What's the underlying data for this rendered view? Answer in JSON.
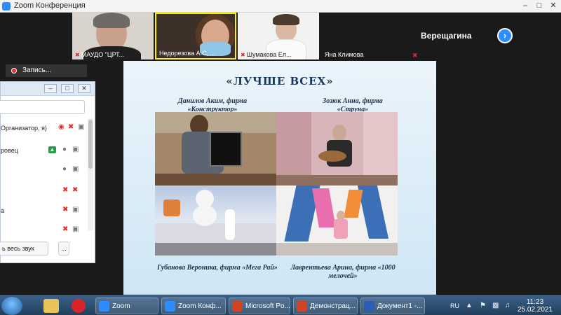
{
  "window": {
    "title": "Zoom Конференция"
  },
  "video_strip": {
    "tiles": [
      {
        "name": "МАУДО \"ЦРТ..."
      },
      {
        "name": "Недорезова А.С, ..."
      },
      {
        "name": "Шумакова Ел..."
      },
      {
        "name": "Яна Климова"
      }
    ],
    "active_speaker": "Верещагина"
  },
  "recording": {
    "label": "Запись..."
  },
  "slide": {
    "title": "«ЛУЧШЕ ВСЕХ»",
    "captions": {
      "top_left": "Данилов Аким, фирма «Конструктор»",
      "top_right": "Зозюк Анна, фирма «Струна»",
      "bottom_left": "Губанова Вероника, фирма «Мега Рай»",
      "bottom_right": "Лаврентьева Арина, фирма «1000 мелочей»"
    }
  },
  "participants_panel": {
    "rows": [
      {
        "text": "Организатор, я)"
      },
      {
        "text": "ровец"
      },
      {
        "text": ""
      },
      {
        "text": ""
      },
      {
        "text": "а"
      },
      {
        "text": ""
      }
    ],
    "footer": {
      "mute_all": "ь весь звук",
      "more": "..."
    }
  },
  "taskbar": {
    "tasks": [
      {
        "label": "Zoom"
      },
      {
        "label": "Zoom Конф..."
      },
      {
        "label": "Microsoft Po..."
      },
      {
        "label": "Демонстрац..."
      },
      {
        "label": "Документ1 -..."
      }
    ],
    "lang": "RU",
    "time": "11:23",
    "date": "25.02.2021"
  },
  "colors": {
    "zoom_blue": "#2d8cff",
    "muted_red": "#e02828",
    "slide_title": "#17365d"
  },
  "icons": [
    "zoom-app-icon",
    "minimize-icon",
    "maximize-icon",
    "close-icon",
    "muted-mic-icon",
    "next-page-icon",
    "record-icon",
    "video-icon",
    "video-off-icon",
    "mic-icon",
    "share-icon",
    "windows-start-icon",
    "folder-icon",
    "opera-icon",
    "zoom-icon",
    "powerpoint-icon",
    "word-icon",
    "network-icon",
    "volume-icon"
  ]
}
